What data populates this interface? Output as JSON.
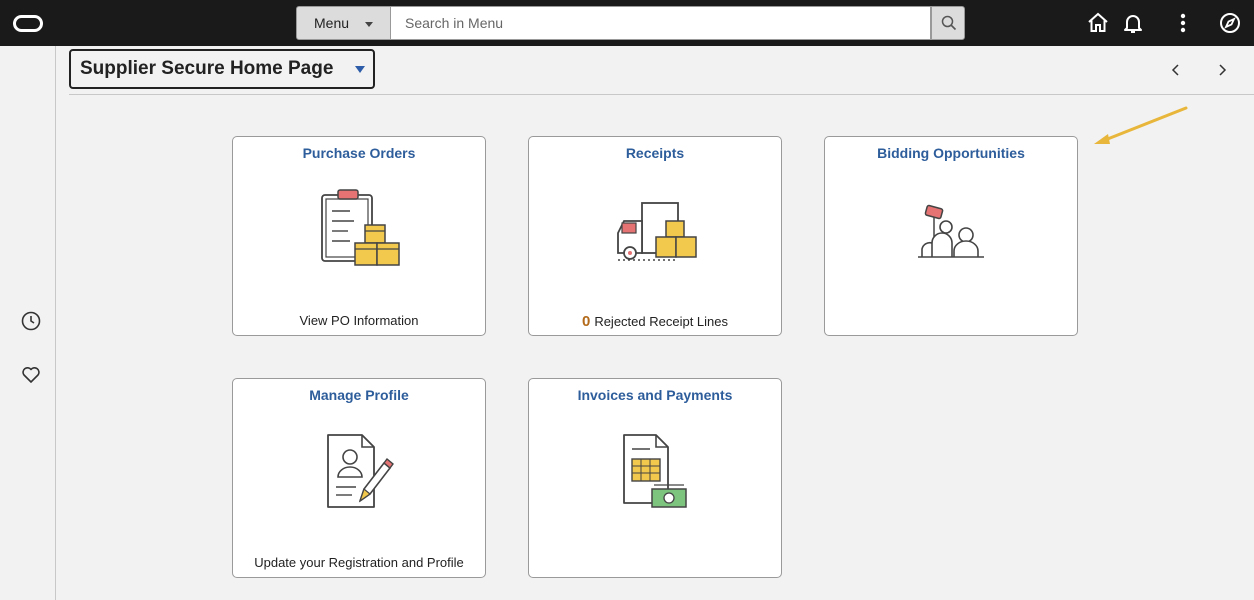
{
  "topbar": {
    "menu_label": "Menu",
    "search_placeholder": "Search in Menu",
    "icons": [
      "oracle-logo",
      "search-icon",
      "home-icon",
      "bell-icon",
      "more-vertical-icon",
      "compass-icon"
    ]
  },
  "leftrail": {
    "icons": [
      "clock-icon",
      "heart-icon"
    ]
  },
  "header": {
    "title": "Supplier Secure Home Page",
    "nav": [
      "chevron-left-icon",
      "chevron-right-icon"
    ]
  },
  "tiles": [
    {
      "title": "Purchase Orders",
      "footer": "View PO Information",
      "icon": "clipboard-boxes-icon"
    },
    {
      "title": "Receipts",
      "count": "0",
      "footer": "Rejected Receipt Lines",
      "icon": "truck-boxes-icon"
    },
    {
      "title": "Bidding Opportunities",
      "footer": "",
      "icon": "bidding-people-icon"
    },
    {
      "title": "Manage Profile",
      "footer": "Update your Registration and Profile",
      "icon": "profile-edit-icon"
    },
    {
      "title": "Invoices and Payments",
      "footer": "",
      "icon": "invoice-money-icon"
    }
  ],
  "colors": {
    "topbar_bg": "#1a1a1a",
    "tile_title": "#2e5d9b",
    "accent_count": "#b36a1a",
    "annotation_arrow": "#e8b63a"
  }
}
